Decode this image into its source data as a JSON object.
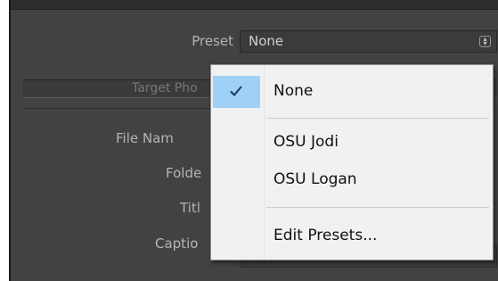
{
  "form": {
    "preset_label": "Preset",
    "preset_value": "None",
    "section_title": "Target Pho",
    "file_name_label": "File Nam",
    "folder_label": "Folde",
    "title_label": "Titl",
    "caption_label": "Captio"
  },
  "menu": {
    "items": [
      {
        "label": "None",
        "checked": true
      },
      {
        "label": "OSU Jodi",
        "checked": false
      },
      {
        "label": "OSU Logan",
        "checked": false
      },
      {
        "label": "Edit Presets...",
        "checked": false
      }
    ]
  },
  "colors": {
    "panel_bg": "#424242",
    "menu_bg": "#f1f1f1",
    "check_highlight": "#9fd0f5"
  },
  "icons": {
    "stepper": "up-down-stepper-icon",
    "check": "checkmark-icon"
  }
}
